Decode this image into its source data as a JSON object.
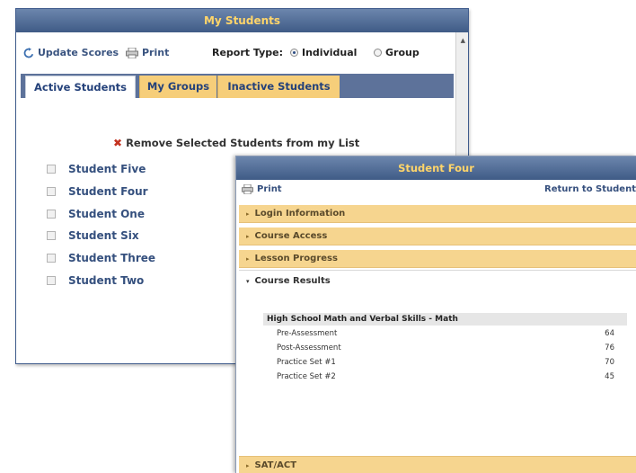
{
  "my_students": {
    "title": "My Students",
    "toolbar": {
      "update_scores": "Update Scores",
      "print": "Print",
      "report_type_label": "Report Type:",
      "options": [
        "Individual",
        "Group"
      ],
      "selected": "Individual"
    },
    "tabs": [
      "Active Students",
      "My Groups",
      "Inactive Students"
    ],
    "active_tab": "Active Students",
    "remove_label": "Remove Selected Students from my List",
    "students": [
      "Student Five",
      "Student Four",
      "Student One",
      "Student Six",
      "Student Three",
      "Student Two"
    ]
  },
  "student_detail": {
    "title": "Student Four",
    "print": "Print",
    "return_link": "Return to Student",
    "sections": [
      "Login Information",
      "Course Access",
      "Lesson Progress"
    ],
    "open_section": "Course Results",
    "course": {
      "name": "High School Math and Verbal Skills - Math",
      "results": [
        {
          "label": "Pre-Assessment",
          "score": "64"
        },
        {
          "label": "Post-Assessment",
          "score": "76"
        },
        {
          "label": "Practice Set #1",
          "score": "70"
        },
        {
          "label": "Practice Set #2",
          "score": "45"
        }
      ]
    },
    "bottom_section": "SAT/ACT"
  },
  "colors": {
    "titlebar": "#4f6a94",
    "title_text": "#ffd56a",
    "tab_inactive": "#f6ce7a",
    "accordion": "#f6d58f",
    "link": "#35507e"
  },
  "icons": {
    "update": "refresh-icon",
    "print": "printer-icon",
    "remove": "red-x-icon"
  }
}
